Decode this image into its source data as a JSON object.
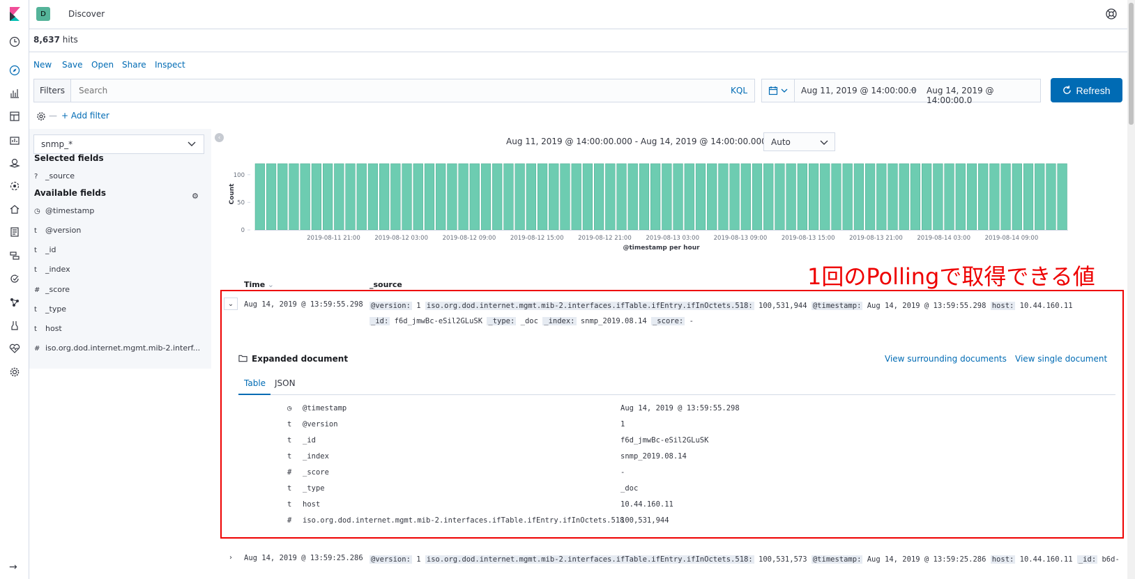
{
  "app": {
    "breadcrumb": "Discover",
    "space_initial": "D"
  },
  "hits": {
    "count": "8,637",
    "label": "hits"
  },
  "menu": [
    "New",
    "Save",
    "Open",
    "Share",
    "Inspect"
  ],
  "query": {
    "filters_label": "Filters",
    "search_placeholder": "Search",
    "language": "KQL",
    "add_filter": "+ Add filter"
  },
  "time": {
    "start": "Aug 11, 2019 @ 14:00:00.0",
    "arrow": "→",
    "end": "Aug 14, 2019 @ 14:00:00.0",
    "refresh": "Refresh"
  },
  "sidebar": {
    "index_pattern": "snmp_*",
    "selected_heading": "Selected fields",
    "selected_fields": [
      {
        "type": "?",
        "name": "_source"
      }
    ],
    "available_heading": "Available fields",
    "available_fields": [
      {
        "type": "clock-icon",
        "name": "@timestamp"
      },
      {
        "type": "t",
        "name": "@version"
      },
      {
        "type": "t",
        "name": "_id"
      },
      {
        "type": "t",
        "name": "_index"
      },
      {
        "type": "#",
        "name": "_score"
      },
      {
        "type": "t",
        "name": "_type"
      },
      {
        "type": "t",
        "name": "host"
      },
      {
        "type": "#",
        "name": "iso.org.dod.internet.mgmt.mib-2.interf..."
      }
    ]
  },
  "chart": {
    "range_text": "Aug 11, 2019 @ 14:00:00.000 - Aug 14, 2019 @ 14:00:00.000 —",
    "interval": "Auto"
  },
  "chart_data": {
    "type": "bar",
    "xlabel": "@timestamp per hour",
    "ylabel": "Count",
    "ylim": [
      0,
      130
    ],
    "yticks": [
      0,
      50,
      100
    ],
    "xtick_labels": [
      "2019-08-11 21:00",
      "2019-08-12 03:00",
      "2019-08-12 09:00",
      "2019-08-12 15:00",
      "2019-08-12 21:00",
      "2019-08-13 03:00",
      "2019-08-13 09:00",
      "2019-08-13 15:00",
      "2019-08-13 21:00",
      "2019-08-14 03:00",
      "2019-08-14 09:00"
    ],
    "bar_count": 72,
    "bar_value": 120,
    "color": "#6dccb1"
  },
  "table": {
    "col_time": "Time",
    "col_source": "_source",
    "rows": [
      {
        "time": "Aug 14, 2019 @ 13:59:55.298",
        "line1": [
          {
            "k": "@version:",
            "v": "1"
          },
          {
            "k": "iso.org.dod.internet.mgmt.mib-2.interfaces.ifTable.ifEntry.ifInOctets.518:",
            "v": "100,531,944"
          },
          {
            "k": "@timestamp:",
            "v": "Aug 14, 2019 @ 13:59:55.298"
          },
          {
            "k": "host:",
            "v": "10.44.160.11"
          }
        ],
        "line2": [
          {
            "k": "_id:",
            "v": "f6d_jmwBc-eSil2GLuSK"
          },
          {
            "k": "_type:",
            "v": "_doc"
          },
          {
            "k": "_index:",
            "v": "snmp_2019.08.14"
          },
          {
            "k": "_score:",
            "v": "-"
          }
        ]
      },
      {
        "time": "Aug 14, 2019 @ 13:59:25.286",
        "line1": [
          {
            "k": "@version:",
            "v": "1"
          },
          {
            "k": "iso.org.dod.internet.mgmt.mib-2.interfaces.ifTable.ifEntry.ifInOctets.518:",
            "v": "100,531,573"
          },
          {
            "k": "@timestamp:",
            "v": "Aug 14, 2019 @ 13:59:25.286"
          },
          {
            "k": "host:",
            "v": "10.44.160.11"
          },
          {
            "k": "_id:",
            "v": "b6d-"
          }
        ]
      }
    ]
  },
  "expanded": {
    "title": "Expanded document",
    "link_surrounding": "View surrounding documents",
    "link_single": "View single document",
    "tabs": [
      "Table",
      "JSON"
    ],
    "rows": [
      {
        "type": "clock-icon",
        "key": "@timestamp",
        "value": "Aug 14, 2019 @ 13:59:55.298"
      },
      {
        "type": "t",
        "key": "@version",
        "value": "1"
      },
      {
        "type": "t",
        "key": "_id",
        "value": "f6d_jmwBc-eSil2GLuSK"
      },
      {
        "type": "t",
        "key": "_index",
        "value": "snmp_2019.08.14"
      },
      {
        "type": "#",
        "key": "_score",
        "value": " -"
      },
      {
        "type": "t",
        "key": "_type",
        "value": "_doc"
      },
      {
        "type": "t",
        "key": "host",
        "value": "10.44.160.11"
      },
      {
        "type": "#",
        "key": "iso.org.dod.internet.mgmt.mib-2.interfaces.ifTable.ifEntry.ifInOctets.518",
        "value": "100,531,944"
      }
    ]
  },
  "annotation": {
    "text": "1回のPollingで取得できる値",
    "color": "#e00000"
  }
}
